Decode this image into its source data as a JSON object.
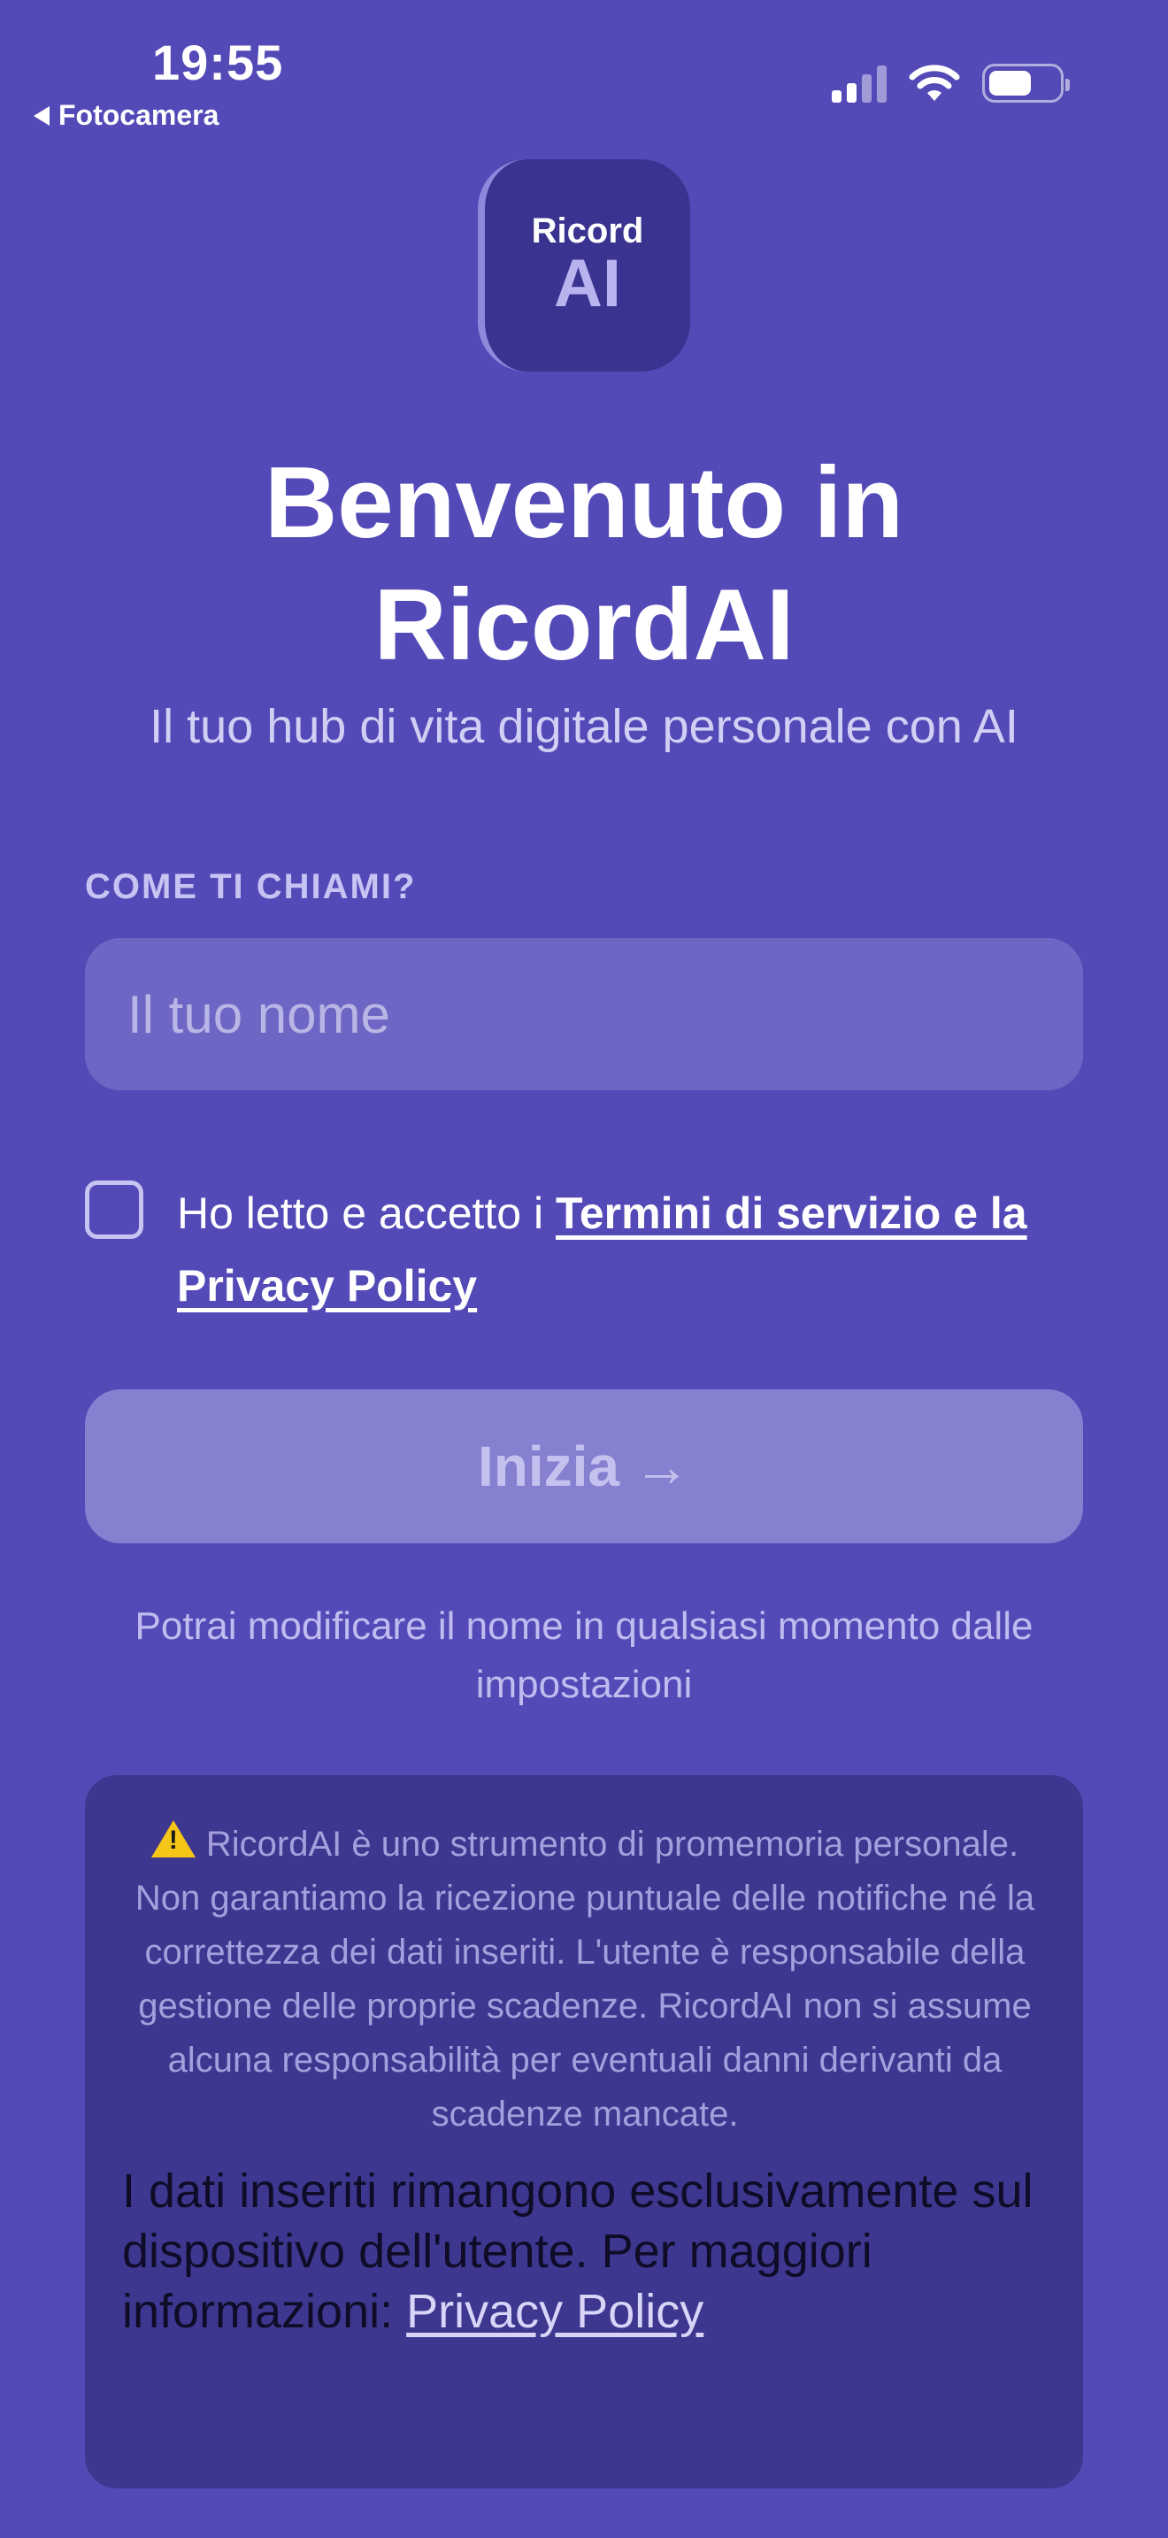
{
  "status_bar": {
    "time": "19:55",
    "back_label": "Fotocamera",
    "icons": [
      "cellular-signal-icon",
      "wifi-icon",
      "battery-icon"
    ]
  },
  "logo": {
    "line1": "Ricord",
    "line2": "AI"
  },
  "header": {
    "title": "Benvenuto in RicordAI",
    "subtitle": "Il tuo hub di vita digitale personale con AI"
  },
  "form": {
    "name_label": "COME TI CHIAMI?",
    "name_placeholder": "Il tuo nome",
    "name_value": "",
    "consent_prefix": "Ho letto e accetto i ",
    "consent_link": "Termini di servizio e la Privacy Policy",
    "consent_checked": false,
    "start_label": "Inizia",
    "start_arrow": "→",
    "hint": "Potrai modificare il nome in qualsiasi momento dalle impostazioni"
  },
  "disclaimer": {
    "warning": "RicordAI è uno strumento di promemoria personale. Non garantiamo la ricezione puntuale delle notifiche né la correttezza dei dati inseriti. L'utente è responsabile della gestione delle proprie scadenze. RicordAI non si assume alcuna responsabilità per eventuali danni derivanti da scadenze mancate.",
    "privacy_text": "I dati inseriti rimangono esclusivamente sul dispositivo dell'utente. Per maggiori informazioni: ",
    "privacy_link": "Privacy Policy"
  },
  "colors": {
    "background": "#534AB7",
    "logo_bg": "#3A3390",
    "input_bg": "#6D66C4",
    "button_disabled": "#8680D0",
    "disclaimer_bg": "#3E378F",
    "warning_yellow": "#F5C518"
  }
}
